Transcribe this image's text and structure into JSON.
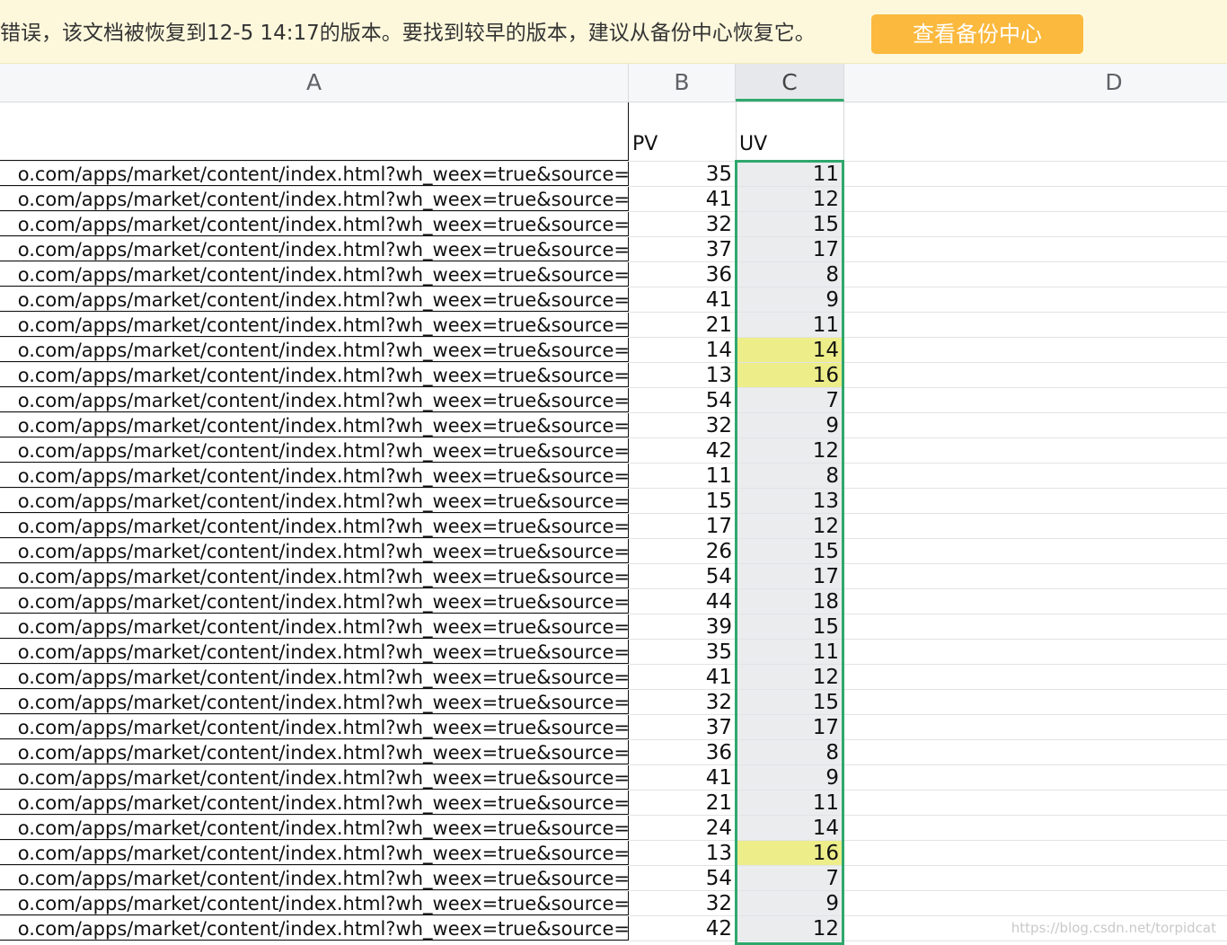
{
  "banner": {
    "message": "错误，该文档被恢复到12-5 14:17的版本。要找到较早的版本，建议从备份中心恢复它。",
    "button_label": "查看备份中心",
    "background_color": "#fdf8dc",
    "button_color": "#fbb93d"
  },
  "columns": [
    "A",
    "B",
    "C",
    "D"
  ],
  "header_row": {
    "b": "PV",
    "c": "UV"
  },
  "url_text": "o.com/apps/market/content/index.html?wh_weex=true&source=",
  "rows": [
    {
      "pv": "35",
      "uv": "11",
      "hl": false
    },
    {
      "pv": "41",
      "uv": "12",
      "hl": false
    },
    {
      "pv": "32",
      "uv": "15",
      "hl": false
    },
    {
      "pv": "37",
      "uv": "17",
      "hl": false
    },
    {
      "pv": "36",
      "uv": "8",
      "hl": false
    },
    {
      "pv": "41",
      "uv": "9",
      "hl": false
    },
    {
      "pv": "21",
      "uv": "11",
      "hl": false
    },
    {
      "pv": "14",
      "uv": "14",
      "hl": true
    },
    {
      "pv": "13",
      "uv": "16",
      "hl": true
    },
    {
      "pv": "54",
      "uv": "7",
      "hl": false
    },
    {
      "pv": "32",
      "uv": "9",
      "hl": false
    },
    {
      "pv": "42",
      "uv": "12",
      "hl": false
    },
    {
      "pv": "11",
      "uv": "8",
      "hl": false
    },
    {
      "pv": "15",
      "uv": "13",
      "hl": false
    },
    {
      "pv": "17",
      "uv": "12",
      "hl": false
    },
    {
      "pv": "26",
      "uv": "15",
      "hl": false
    },
    {
      "pv": "54",
      "uv": "17",
      "hl": false
    },
    {
      "pv": "44",
      "uv": "18",
      "hl": false
    },
    {
      "pv": "39",
      "uv": "15",
      "hl": false
    },
    {
      "pv": "35",
      "uv": "11",
      "hl": false
    },
    {
      "pv": "41",
      "uv": "12",
      "hl": false
    },
    {
      "pv": "32",
      "uv": "15",
      "hl": false
    },
    {
      "pv": "37",
      "uv": "17",
      "hl": false
    },
    {
      "pv": "36",
      "uv": "8",
      "hl": false
    },
    {
      "pv": "41",
      "uv": "9",
      "hl": false
    },
    {
      "pv": "21",
      "uv": "11",
      "hl": false
    },
    {
      "pv": "24",
      "uv": "14",
      "hl": false
    },
    {
      "pv": "13",
      "uv": "16",
      "hl": true
    },
    {
      "pv": "54",
      "uv": "7",
      "hl": false
    },
    {
      "pv": "32",
      "uv": "9",
      "hl": false
    },
    {
      "pv": "42",
      "uv": "12",
      "hl": false
    }
  ],
  "colors": {
    "selection_border": "#2fa86d",
    "highlight_fill": "#eded8a",
    "selected_column_fill": "#ebecee"
  },
  "watermark": "https://blog.csdn.net/torpidcat"
}
